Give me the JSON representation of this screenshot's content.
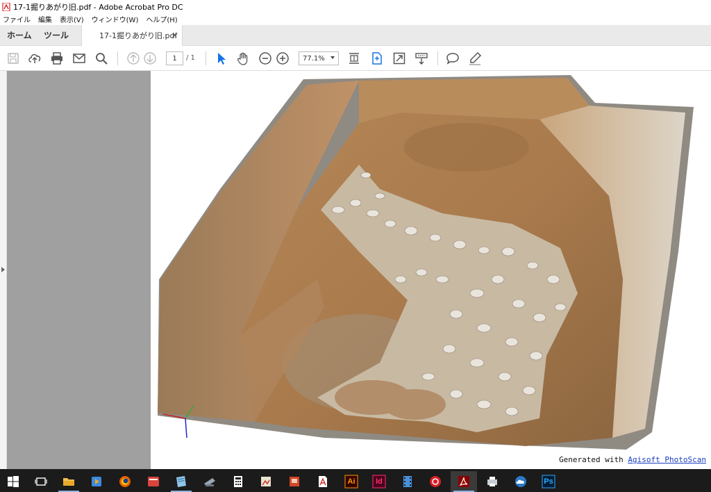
{
  "window": {
    "title": "17-1掘りあがり旧.pdf - Adobe Acrobat Pro DC"
  },
  "menu": [
    "ファイル",
    "編集",
    "表示(V)",
    "ウィンドウ(W)",
    "ヘルプ(H)"
  ],
  "tabs": {
    "home": "ホーム",
    "tools": "ツール",
    "document": "17-1掘りあがり旧.pdf",
    "close": "×"
  },
  "toolbar": {
    "page_current": "1",
    "page_total": "/ 1",
    "zoom": "77.1%",
    "icons": [
      "save-icon",
      "upload-cloud-icon",
      "print-icon",
      "email-icon",
      "search-icon",
      "page-up-icon",
      "page-down-icon",
      "select-cursor-icon",
      "hand-icon",
      "zoom-out-icon",
      "zoom-in-icon",
      "scroll-mode-icon",
      "fit-page-icon",
      "full-screen-icon",
      "read-mode-icon",
      "comment-icon",
      "highlight-pen-icon"
    ]
  },
  "document": {
    "footer_prefix": "Generated with ",
    "footer_link": "Agisoft PhotoScan"
  },
  "taskbar": {
    "items": [
      "start",
      "task-view",
      "file-explorer",
      "media-player",
      "firefox",
      "app-red",
      "app-notes",
      "app-scanner",
      "calculator",
      "app-viewer",
      "powerpoint",
      "acrobat-reader",
      "illustrator",
      "indesign",
      "app-film",
      "creative-cloud",
      "acrobat-pro",
      "app-print",
      "app-cloud",
      "photoshop"
    ],
    "labels": {
      "illustrator": "Ai",
      "indesign": "Id",
      "photoshop": "Ps"
    }
  },
  "colors": {
    "accent": "#1473e6",
    "taskbar": "#1b1b1b",
    "pane_gray": "#a0a0a0"
  }
}
